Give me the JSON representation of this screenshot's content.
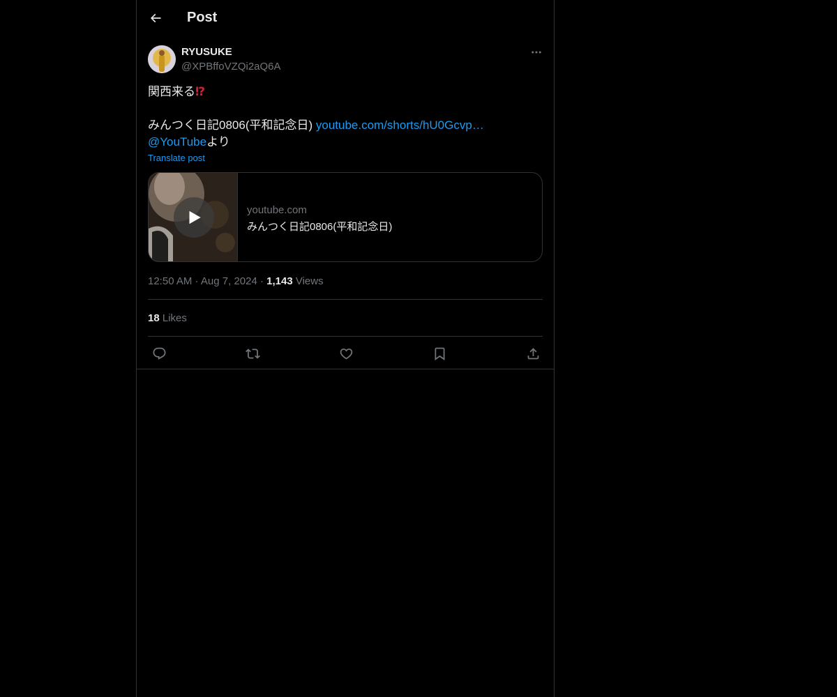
{
  "header": {
    "title": "Post",
    "back_icon": "arrow-left-icon"
  },
  "author": {
    "name": "RYUSUKE",
    "handle": "@XPBffoVZQi2aQ6A",
    "more_icon": "more-horizontal-icon"
  },
  "post": {
    "line1_text": "関西来る",
    "line1_emoji": "⁉",
    "line3_text": "みんつく日記0806(平和記念日) ",
    "line3_link": "youtube.com/shorts/hU0Gcvp…",
    "line4_mention": "@YouTube",
    "line4_suffix": "より",
    "translate_label": "Translate post"
  },
  "card": {
    "domain": "youtube.com",
    "title": "みんつく日記0806(平和記念日)",
    "play_icon": "play-icon"
  },
  "meta": {
    "time": "12:50 AM",
    "sep1": " · ",
    "date": "Aug 7, 2024",
    "sep2": " · ",
    "views_count": "1,143",
    "views_label": " Views"
  },
  "stats": {
    "likes_count": "18",
    "likes_label": " Likes"
  },
  "actions": [
    "reply-icon",
    "repost-icon",
    "like-icon",
    "bookmark-icon",
    "share-icon"
  ],
  "colors": {
    "background": "#000000",
    "text": "#e7e9ea",
    "muted": "#71767b",
    "link": "#1d9bf0",
    "border": "#2f3336",
    "alert": "#d0203a"
  }
}
